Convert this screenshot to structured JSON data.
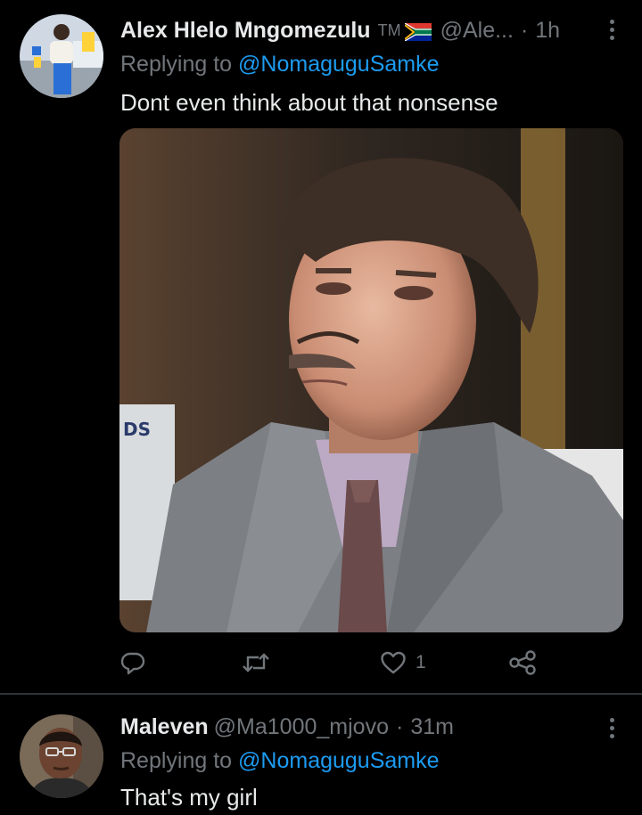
{
  "tweets": [
    {
      "display_name": "Alex Hlelo Mngomezulu",
      "tm_badge": "TM",
      "flag_icon": "south-africa-flag-icon",
      "handle": "@Ale...",
      "separator": "·",
      "time": "1h",
      "replying_prefix": "Replying to",
      "replying_to": "@NomaguguSamke",
      "text": "Dont even think about that nonsense",
      "has_media": true,
      "actions": {
        "reply_icon": "reply-icon",
        "retweet_icon": "retweet-icon",
        "like_icon": "heart-icon",
        "like_count": "1",
        "share_icon": "share-icon"
      }
    },
    {
      "display_name": "Maleven",
      "handle": "@Ma1000_mjovo",
      "separator": "·",
      "time": "31m",
      "replying_prefix": "Replying to",
      "replying_to": "@NomaguguSamke",
      "text": "That's my girl"
    }
  ],
  "colors": {
    "background": "#000000",
    "primary_text": "#e7e9ea",
    "secondary_text": "#71767b",
    "accent": "#1d9bf0",
    "divider": "#2f3336"
  }
}
